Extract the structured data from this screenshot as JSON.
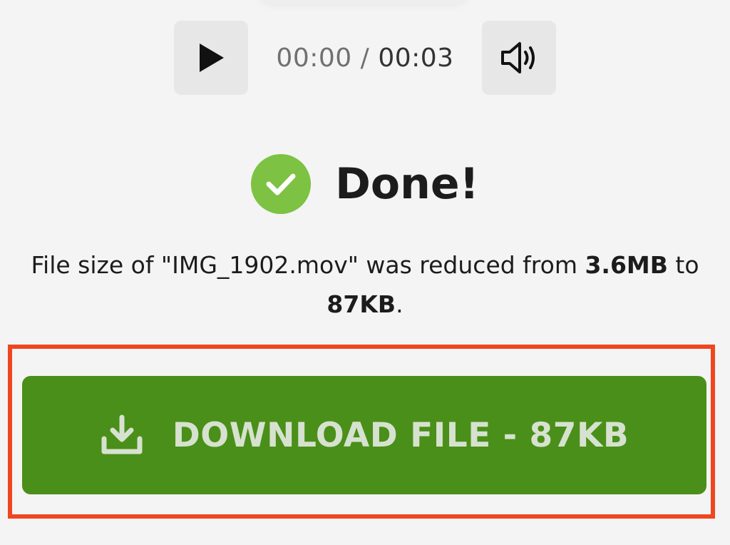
{
  "player": {
    "play_icon": "play-icon",
    "current_time": "00:00",
    "separator": "/",
    "total_time": "00:03",
    "volume_icon": "volume-icon"
  },
  "status": {
    "icon": "check-circle-icon",
    "title": "Done!",
    "colors": {
      "check": "#7dc242"
    }
  },
  "message": {
    "prefix": "File size of \"IMG_1902.mov\" was reduced from ",
    "original_size": "3.6MB",
    "middle": " to",
    "new_size": "87KB",
    "suffix": "."
  },
  "download": {
    "icon": "download-icon",
    "label": "DOWNLOAD FILE - 87KB",
    "colors": {
      "button": "#4a8f19",
      "highlight": "#f0461f"
    }
  }
}
